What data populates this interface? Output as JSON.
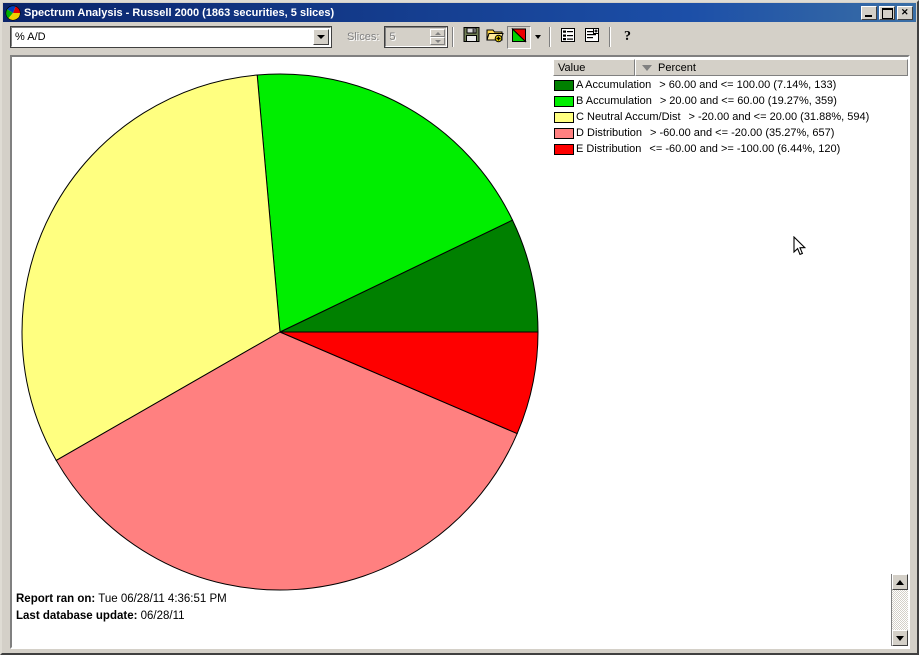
{
  "window": {
    "title": "Spectrum Analysis - Russell 2000 (1863 securities, 5 slices)",
    "app_icon": "pie-chart-icon",
    "minimize_label": "",
    "maximize_label": "",
    "close_label": ""
  },
  "toolbar": {
    "combo_value": "% A/D",
    "combo_placeholder": "% A/D",
    "slices_label": "Slices:",
    "slices_value": "5",
    "buttons": [
      {
        "name": "save-button",
        "icon": "floppy-disk-icon",
        "label": "Save"
      },
      {
        "name": "open-button",
        "icon": "open-folder-add-icon",
        "label": "Open"
      },
      {
        "name": "pie-chart-view-button",
        "icon": "pie-chart-icon",
        "label": "Pie Chart",
        "pressed": true
      },
      {
        "name": "chart-type-dropdown-button",
        "icon": "chevron-down-icon",
        "label": "Chart Type"
      },
      {
        "name": "report-list-button",
        "icon": "list-report-icon",
        "label": "Report List"
      },
      {
        "name": "add-report-button",
        "icon": "list-add-icon",
        "label": "Add Report"
      },
      {
        "name": "help-button",
        "icon": "question-mark-icon",
        "label": "Help"
      }
    ]
  },
  "legend": {
    "columns": [
      "Value",
      "Percent"
    ],
    "sort_indicator": "descending",
    "rows": [
      {
        "color": "#008000",
        "name": "A Accumulation",
        "desc": "> 60.00 and <= 100.00 (7.14%, 133)"
      },
      {
        "color": "#00ee00",
        "name": "B Accumulation",
        "desc": "> 20.00 and <= 60.00 (19.27%, 359)"
      },
      {
        "color": "#ffff80",
        "name": "C Neutral Accum/Dist",
        "desc": "> -20.00 and <= 20.00 (31.88%, 594)"
      },
      {
        "color": "#ff8080",
        "name": "D Distribution",
        "desc": "> -60.00 and <= -20.00 (35.27%, 657)"
      },
      {
        "color": "#fe0000",
        "name": "E Distribution",
        "desc": "<= -60.00 and >= -100.00 (6.44%, 120)"
      }
    ]
  },
  "footer": {
    "report_ran_label": "Report ran on:",
    "report_ran_value": "Tue 06/28/11 4:36:51 PM",
    "db_update_label": "Last database update:",
    "db_update_value": "06/28/11"
  },
  "chart_data": {
    "type": "pie",
    "title": "Spectrum Analysis - Russell 2000",
    "subtitle": "1863 securities, 5 slices",
    "metric": "% A/D",
    "total_count": 1863,
    "start_angle_deg": 0,
    "direction": "counterclockwise",
    "center": [
      278,
      328
    ],
    "radius": 258,
    "labels": [
      "A Accumulation",
      "B Accumulation",
      "C Neutral Accum/Dist",
      "D Distribution",
      "E Distribution"
    ],
    "values": [
      7.14,
      19.27,
      31.88,
      35.27,
      6.44
    ],
    "counts": [
      133,
      359,
      594,
      657,
      120
    ],
    "colors": [
      "#008000",
      "#00ee00",
      "#ffff80",
      "#ff8080",
      "#fe0000"
    ],
    "ranges": [
      "> 60.00 and <= 100.00",
      "> 20.00 and <= 60.00",
      "> -20.00 and <= 20.00",
      "> -60.00 and <= -20.00",
      "<= -60.00 and >= -100.00"
    ],
    "legend_position": "top-right",
    "slice_border_color": "#000000"
  }
}
